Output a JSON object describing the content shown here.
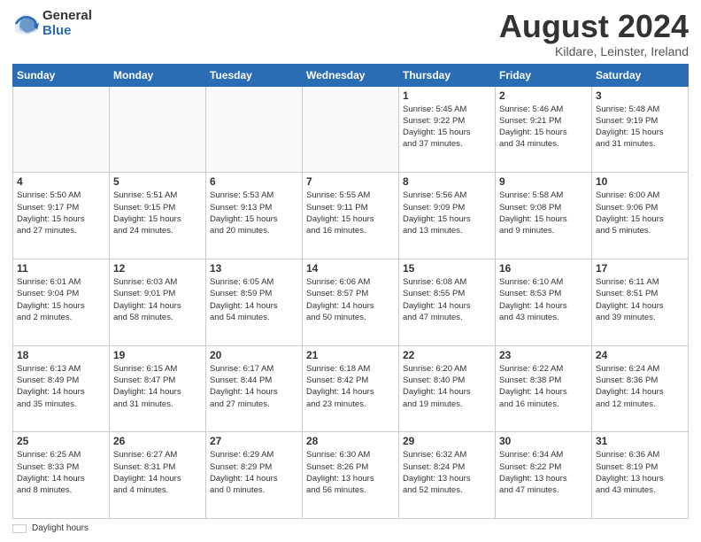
{
  "header": {
    "logo_general": "General",
    "logo_blue": "Blue",
    "title": "August 2024",
    "location": "Kildare, Leinster, Ireland"
  },
  "days_of_week": [
    "Sunday",
    "Monday",
    "Tuesday",
    "Wednesday",
    "Thursday",
    "Friday",
    "Saturday"
  ],
  "weeks": [
    [
      {
        "day": "",
        "info": ""
      },
      {
        "day": "",
        "info": ""
      },
      {
        "day": "",
        "info": ""
      },
      {
        "day": "",
        "info": ""
      },
      {
        "day": "1",
        "info": "Sunrise: 5:45 AM\nSunset: 9:22 PM\nDaylight: 15 hours\nand 37 minutes."
      },
      {
        "day": "2",
        "info": "Sunrise: 5:46 AM\nSunset: 9:21 PM\nDaylight: 15 hours\nand 34 minutes."
      },
      {
        "day": "3",
        "info": "Sunrise: 5:48 AM\nSunset: 9:19 PM\nDaylight: 15 hours\nand 31 minutes."
      }
    ],
    [
      {
        "day": "4",
        "info": "Sunrise: 5:50 AM\nSunset: 9:17 PM\nDaylight: 15 hours\nand 27 minutes."
      },
      {
        "day": "5",
        "info": "Sunrise: 5:51 AM\nSunset: 9:15 PM\nDaylight: 15 hours\nand 24 minutes."
      },
      {
        "day": "6",
        "info": "Sunrise: 5:53 AM\nSunset: 9:13 PM\nDaylight: 15 hours\nand 20 minutes."
      },
      {
        "day": "7",
        "info": "Sunrise: 5:55 AM\nSunset: 9:11 PM\nDaylight: 15 hours\nand 16 minutes."
      },
      {
        "day": "8",
        "info": "Sunrise: 5:56 AM\nSunset: 9:09 PM\nDaylight: 15 hours\nand 13 minutes."
      },
      {
        "day": "9",
        "info": "Sunrise: 5:58 AM\nSunset: 9:08 PM\nDaylight: 15 hours\nand 9 minutes."
      },
      {
        "day": "10",
        "info": "Sunrise: 6:00 AM\nSunset: 9:06 PM\nDaylight: 15 hours\nand 5 minutes."
      }
    ],
    [
      {
        "day": "11",
        "info": "Sunrise: 6:01 AM\nSunset: 9:04 PM\nDaylight: 15 hours\nand 2 minutes."
      },
      {
        "day": "12",
        "info": "Sunrise: 6:03 AM\nSunset: 9:01 PM\nDaylight: 14 hours\nand 58 minutes."
      },
      {
        "day": "13",
        "info": "Sunrise: 6:05 AM\nSunset: 8:59 PM\nDaylight: 14 hours\nand 54 minutes."
      },
      {
        "day": "14",
        "info": "Sunrise: 6:06 AM\nSunset: 8:57 PM\nDaylight: 14 hours\nand 50 minutes."
      },
      {
        "day": "15",
        "info": "Sunrise: 6:08 AM\nSunset: 8:55 PM\nDaylight: 14 hours\nand 47 minutes."
      },
      {
        "day": "16",
        "info": "Sunrise: 6:10 AM\nSunset: 8:53 PM\nDaylight: 14 hours\nand 43 minutes."
      },
      {
        "day": "17",
        "info": "Sunrise: 6:11 AM\nSunset: 8:51 PM\nDaylight: 14 hours\nand 39 minutes."
      }
    ],
    [
      {
        "day": "18",
        "info": "Sunrise: 6:13 AM\nSunset: 8:49 PM\nDaylight: 14 hours\nand 35 minutes."
      },
      {
        "day": "19",
        "info": "Sunrise: 6:15 AM\nSunset: 8:47 PM\nDaylight: 14 hours\nand 31 minutes."
      },
      {
        "day": "20",
        "info": "Sunrise: 6:17 AM\nSunset: 8:44 PM\nDaylight: 14 hours\nand 27 minutes."
      },
      {
        "day": "21",
        "info": "Sunrise: 6:18 AM\nSunset: 8:42 PM\nDaylight: 14 hours\nand 23 minutes."
      },
      {
        "day": "22",
        "info": "Sunrise: 6:20 AM\nSunset: 8:40 PM\nDaylight: 14 hours\nand 19 minutes."
      },
      {
        "day": "23",
        "info": "Sunrise: 6:22 AM\nSunset: 8:38 PM\nDaylight: 14 hours\nand 16 minutes."
      },
      {
        "day": "24",
        "info": "Sunrise: 6:24 AM\nSunset: 8:36 PM\nDaylight: 14 hours\nand 12 minutes."
      }
    ],
    [
      {
        "day": "25",
        "info": "Sunrise: 6:25 AM\nSunset: 8:33 PM\nDaylight: 14 hours\nand 8 minutes."
      },
      {
        "day": "26",
        "info": "Sunrise: 6:27 AM\nSunset: 8:31 PM\nDaylight: 14 hours\nand 4 minutes."
      },
      {
        "day": "27",
        "info": "Sunrise: 6:29 AM\nSunset: 8:29 PM\nDaylight: 14 hours\nand 0 minutes."
      },
      {
        "day": "28",
        "info": "Sunrise: 6:30 AM\nSunset: 8:26 PM\nDaylight: 13 hours\nand 56 minutes."
      },
      {
        "day": "29",
        "info": "Sunrise: 6:32 AM\nSunset: 8:24 PM\nDaylight: 13 hours\nand 52 minutes."
      },
      {
        "day": "30",
        "info": "Sunrise: 6:34 AM\nSunset: 8:22 PM\nDaylight: 13 hours\nand 47 minutes."
      },
      {
        "day": "31",
        "info": "Sunrise: 6:36 AM\nSunset: 8:19 PM\nDaylight: 13 hours\nand 43 minutes."
      }
    ]
  ],
  "footer": {
    "legend_label": "Daylight hours"
  }
}
